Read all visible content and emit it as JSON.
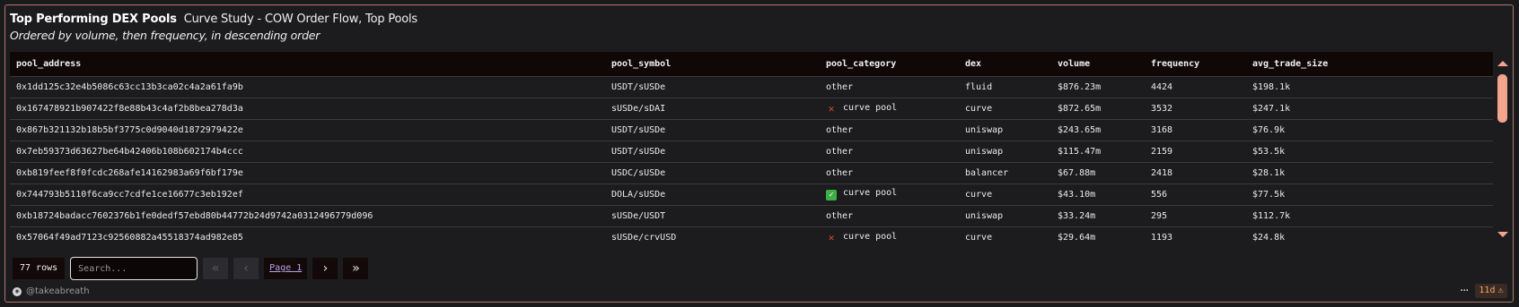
{
  "header": {
    "title": "Top Performing DEX Pools",
    "subtitle": "Curve Study - COW Order Flow, Top Pools",
    "description": "Ordered by volume, then frequency, in descending order"
  },
  "table": {
    "columns": [
      "pool_address",
      "pool_symbol",
      "pool_category",
      "dex",
      "volume",
      "frequency",
      "avg_trade_size"
    ],
    "rows": [
      {
        "pool_address": "0x1dd125c32e4b5086c63cc13b3ca02c4a2a61fa9b",
        "pool_symbol": "USDT/sUSDe",
        "pool_category": "other",
        "category_icon": "",
        "dex": "fluid",
        "volume": "$876.23m",
        "frequency": "4424",
        "avg_trade_size": "$198.1k"
      },
      {
        "pool_address": "0x167478921b907422f8e88b43c4af2b8bea278d3a",
        "pool_symbol": "sUSDe/sDAI",
        "pool_category": "curve pool",
        "category_icon": "x-mark-icon",
        "dex": "curve",
        "volume": "$872.65m",
        "frequency": "3532",
        "avg_trade_size": "$247.1k"
      },
      {
        "pool_address": "0x867b321132b18b5bf3775c0d9040d1872979422e",
        "pool_symbol": "USDT/sUSDe",
        "pool_category": "other",
        "category_icon": "",
        "dex": "uniswap",
        "volume": "$243.65m",
        "frequency": "3168",
        "avg_trade_size": "$76.9k"
      },
      {
        "pool_address": "0x7eb59373d63627be64b42406b108b602174b4ccc",
        "pool_symbol": "USDT/sUSDe",
        "pool_category": "other",
        "category_icon": "",
        "dex": "uniswap",
        "volume": "$115.47m",
        "frequency": "2159",
        "avg_trade_size": "$53.5k"
      },
      {
        "pool_address": "0xb819feef8f0fcdc268afe14162983a69f6bf179e",
        "pool_symbol": "USDC/sUSDe",
        "pool_category": "other",
        "category_icon": "",
        "dex": "balancer",
        "volume": "$67.88m",
        "frequency": "2418",
        "avg_trade_size": "$28.1k"
      },
      {
        "pool_address": "0x744793b5110f6ca9cc7cdfe1ce16677c3eb192ef",
        "pool_symbol": "DOLA/sUSDe",
        "pool_category": "curve pool",
        "category_icon": "check-mark-icon",
        "dex": "curve",
        "volume": "$43.10m",
        "frequency": "556",
        "avg_trade_size": "$77.5k"
      },
      {
        "pool_address": "0xb18724badacc7602376b1fe0dedf57ebd80b44772b24d9742a0312496779d096",
        "pool_symbol": "sUSDe/USDT",
        "pool_category": "other",
        "category_icon": "",
        "dex": "uniswap",
        "volume": "$33.24m",
        "frequency": "295",
        "avg_trade_size": "$112.7k"
      },
      {
        "pool_address": "0x57064f49ad7123c92560882a45518374ad982e85",
        "pool_symbol": "sUSDe/crvUSD",
        "pool_category": "curve pool",
        "category_icon": "x-mark-icon",
        "dex": "curve",
        "volume": "$29.64m",
        "frequency": "1193",
        "avg_trade_size": "$24.8k"
      }
    ]
  },
  "pager": {
    "rows_count": "77 rows",
    "search_placeholder": "Search...",
    "page_label": "Page 1",
    "first_icon": "«",
    "prev_icon": "‹",
    "next_icon": "›",
    "last_icon": "»"
  },
  "footer": {
    "author": "@takeabreath",
    "more_icon": "···",
    "age": "11d",
    "warn_icon": "⚠"
  },
  "colors": {
    "accent": "#f2a58c",
    "border": "#b07a6a",
    "header_bg": "#100807",
    "x_mark": "#e8442a",
    "check_mark": "#3cae43",
    "page_link": "#b8a2e8"
  }
}
